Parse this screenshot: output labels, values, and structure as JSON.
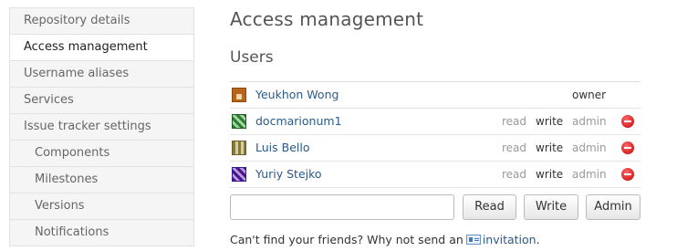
{
  "sidebar": {
    "items": [
      {
        "label": "Repository details"
      },
      {
        "label": "Access management"
      },
      {
        "label": "Username aliases"
      },
      {
        "label": "Services"
      },
      {
        "label": "Issue tracker settings"
      },
      {
        "label": "Components"
      },
      {
        "label": "Milestones"
      },
      {
        "label": "Versions"
      },
      {
        "label": "Notifications"
      }
    ],
    "active": "Access management"
  },
  "main": {
    "title": "Access management",
    "users_heading": "Users",
    "users": [
      {
        "name": "Yeukhon Wong",
        "role": "owner",
        "avatar": "fox-avatar"
      },
      {
        "name": "docmarionum1",
        "read": "read",
        "write": "write",
        "admin": "admin",
        "selected": "write",
        "avatar": "green-identicon"
      },
      {
        "name": "Luis Bello",
        "read": "read",
        "write": "write",
        "admin": "admin",
        "selected": "write",
        "avatar": "olive-identicon"
      },
      {
        "name": "Yuriy Stejko",
        "read": "read",
        "write": "write",
        "admin": "admin",
        "selected": "write",
        "avatar": "purple-identicon"
      }
    ],
    "add_user": {
      "input_value": "",
      "read_label": "Read",
      "write_label": "Write",
      "admin_label": "Admin"
    },
    "invite": {
      "prefix": "Can't find your friends? Why not send an",
      "link": "invitation",
      "suffix": "."
    }
  },
  "colors": {
    "link": "#2a5a8a",
    "remove": "#c40000",
    "sidebar_bg": "#f5f5f5"
  }
}
